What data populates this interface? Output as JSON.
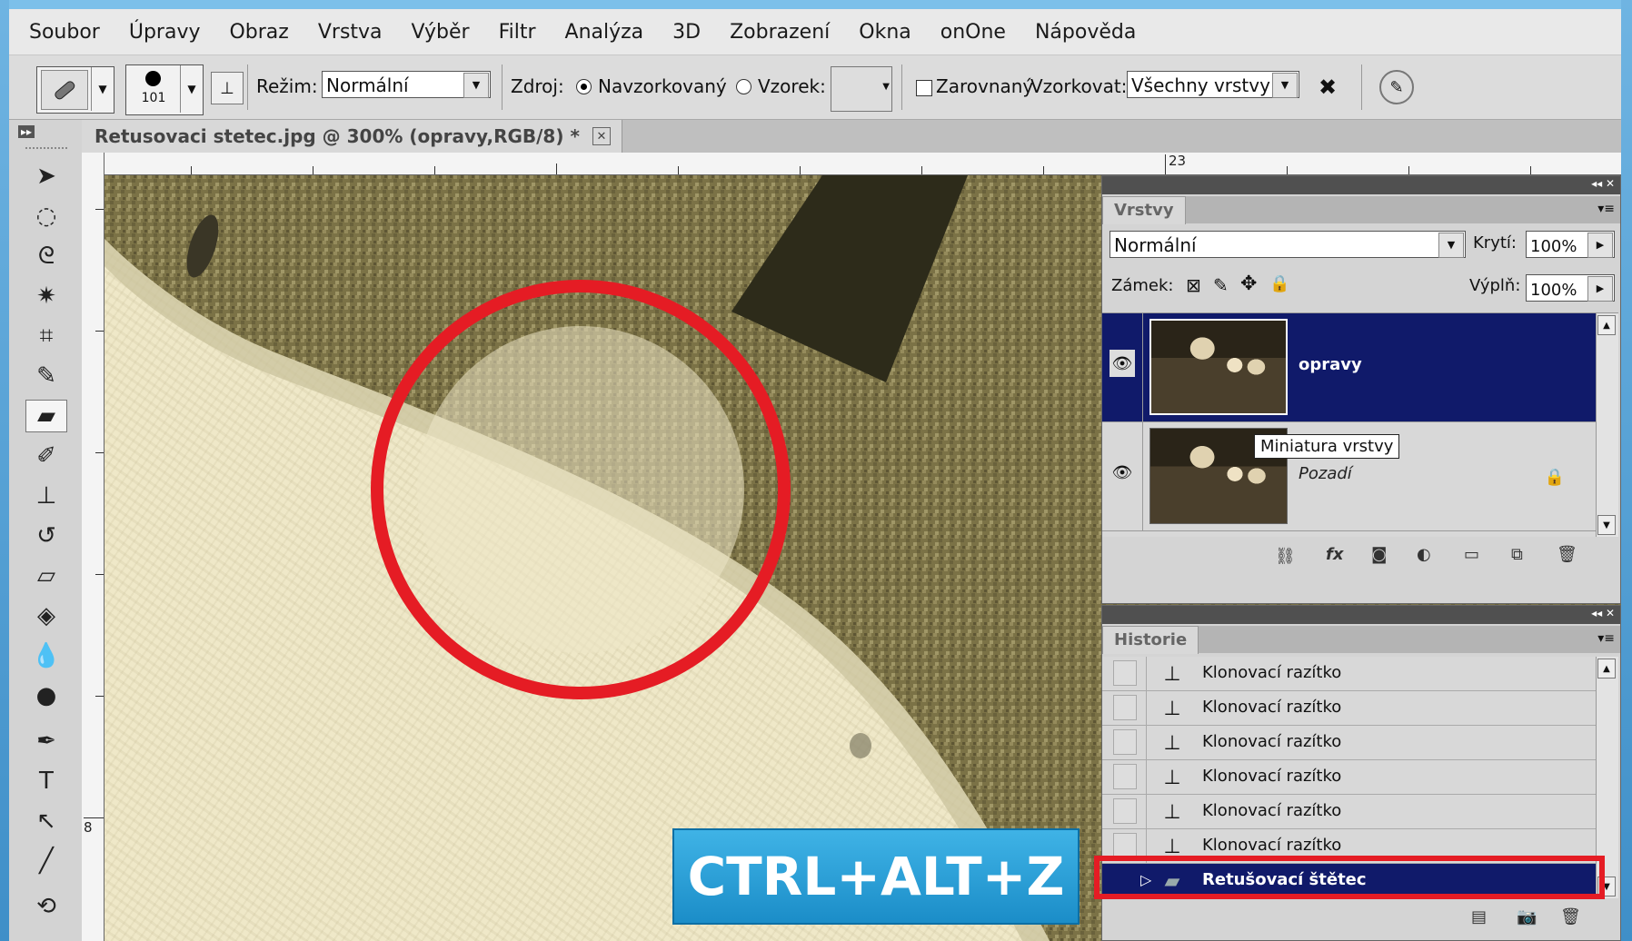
{
  "menu": [
    "Soubor",
    "Úpravy",
    "Obraz",
    "Vrstva",
    "Výběr",
    "Filtr",
    "Analýza",
    "3D",
    "Zobrazení",
    "Okna",
    "onOne",
    "Nápověda"
  ],
  "options": {
    "brush_size": "101",
    "mode_label": "Režim:",
    "mode_value": "Normální",
    "source_label": "Zdroj:",
    "sampled_label": "Navzorkovaný",
    "pattern_label": "Vzorek:",
    "aligned_label": "Zarovnaný",
    "sample_label": "Vzorkovat:",
    "sample_value": "Všechny vrstvy"
  },
  "document": {
    "tab_title": "Retusovaci stetec.jpg @ 300% (opravy,RGB/8) *",
    "close": "✕",
    "ruler_h_label": "23",
    "ruler_v_label": "8"
  },
  "layers_panel": {
    "tab": "Vrstvy",
    "blend_mode": "Normální",
    "opacity_label": "Krytí:",
    "opacity_value": "100%",
    "lock_label": "Zámek:",
    "fill_label": "Výplň:",
    "fill_value": "100%",
    "layers": [
      {
        "name": "opravy",
        "selected": true
      },
      {
        "name": "Pozadí",
        "selected": false
      }
    ],
    "tooltip": "Miniatura vrstvy"
  },
  "history_panel": {
    "tab": "Historie",
    "items": [
      "Klonovací razítko",
      "Klonovací razítko",
      "Klonovací razítko",
      "Klonovací razítko",
      "Klonovací razítko",
      "Klonovací razítko",
      "Retušovací štětec"
    ]
  },
  "overlay": {
    "shortcut": "CTRL+ALT+Z"
  },
  "colors": {
    "selection": "#101a6a",
    "highlight_red": "#e51c24",
    "shortcut_blue": "#1b8dc8"
  }
}
